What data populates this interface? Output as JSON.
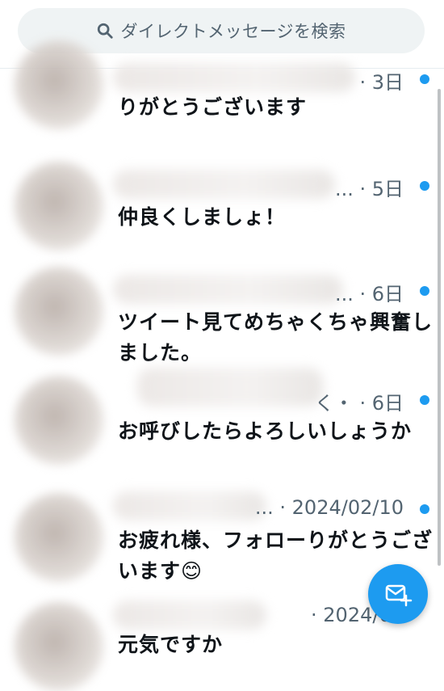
{
  "search": {
    "placeholder": "ダイレクトメッセージを検索",
    "icon": "search-icon"
  },
  "conversations": [
    {
      "meta": "· 3日",
      "preview": "りがとうございます",
      "unread": true
    },
    {
      "meta": "... · 5日",
      "preview": "仲良くしましょ！",
      "unread": true
    },
    {
      "meta": "... · 6日",
      "preview": "ツイート見てめちゃくちゃ興奮しました。",
      "unread": true
    },
    {
      "meta": "く・ · 6日",
      "preview": "お呼びしたらよろしいしょうか",
      "unread": true
    },
    {
      "meta": "... · 2024/02/10",
      "preview": "お疲れ様、フォローりがとうございます😊",
      "unread": true
    },
    {
      "meta": "· 2024/01",
      "preview": "元気ですか",
      "unread": false
    }
  ],
  "fab": {
    "icon": "new-message-icon"
  },
  "colors": {
    "accent": "#1d9bf0",
    "secondary_text": "#536471",
    "search_bg": "#eff3f4"
  }
}
